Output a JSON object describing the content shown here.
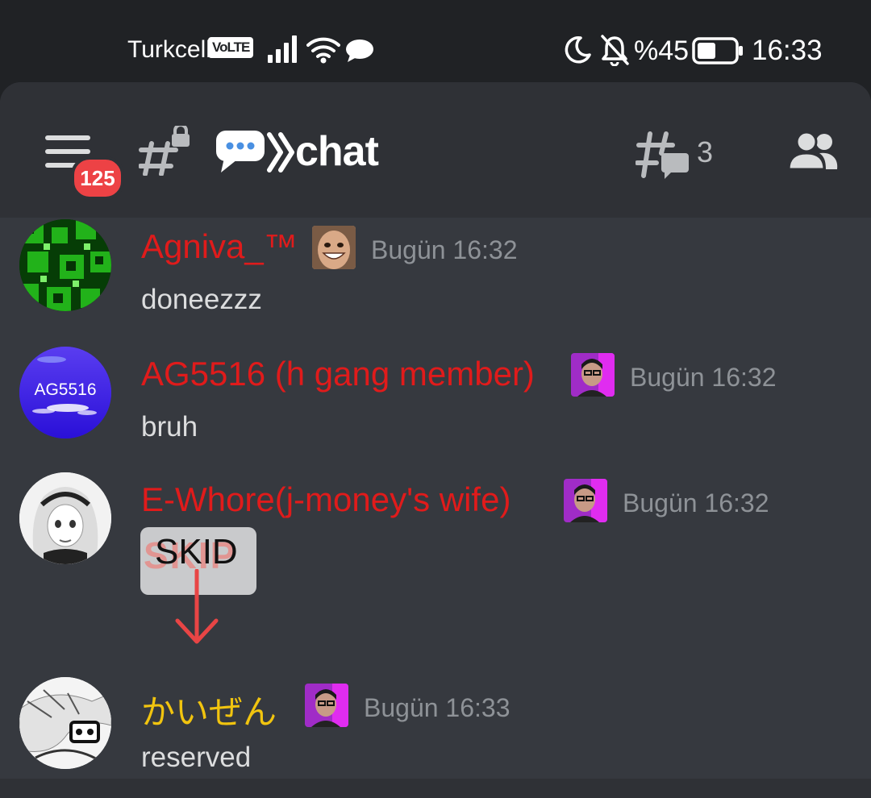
{
  "status_bar": {
    "carrier": "Turkcell",
    "volte": "VoLTE",
    "icons": [
      "signal-icon",
      "wifi-icon",
      "message-bubble-icon",
      "moon-icon",
      "bell-off-icon",
      "battery-icon"
    ],
    "battery": "%45",
    "time": "16:33"
  },
  "header": {
    "menu_badge": "125",
    "channel_emoji": "💬",
    "channel_name": "⟫chat",
    "thread_count": "3",
    "icons": [
      "menu-icon",
      "locked-channel-icon",
      "threads-icon",
      "members-icon"
    ]
  },
  "messages": [
    {
      "author": "Agniva_™",
      "time": "Bugün 16:32",
      "text": "doneezzz",
      "name_color": "#e01b1b"
    },
    {
      "author": "AG5516 (h gang member)",
      "avatar_text": "AG5516",
      "time": "Bugün 16:32",
      "text": "bruh",
      "name_color": "#e01b1b"
    },
    {
      "author": "E-Whore(j-money's wife)",
      "time": "Bugün 16:32",
      "sticker_text": "SKID",
      "sticker_underlay": "SKIP",
      "name_color": "#e01b1b"
    },
    {
      "author": "かいぜん",
      "time": "Bugün 16:33",
      "text": "reserved",
      "name_color": "#f1c40f"
    }
  ],
  "colors": {
    "background": "#36393f",
    "header": "#2f3136",
    "status_bar": "#202225",
    "badge": "#ed4245",
    "timestamp": "#8e9297",
    "arrow": "#e84545"
  }
}
